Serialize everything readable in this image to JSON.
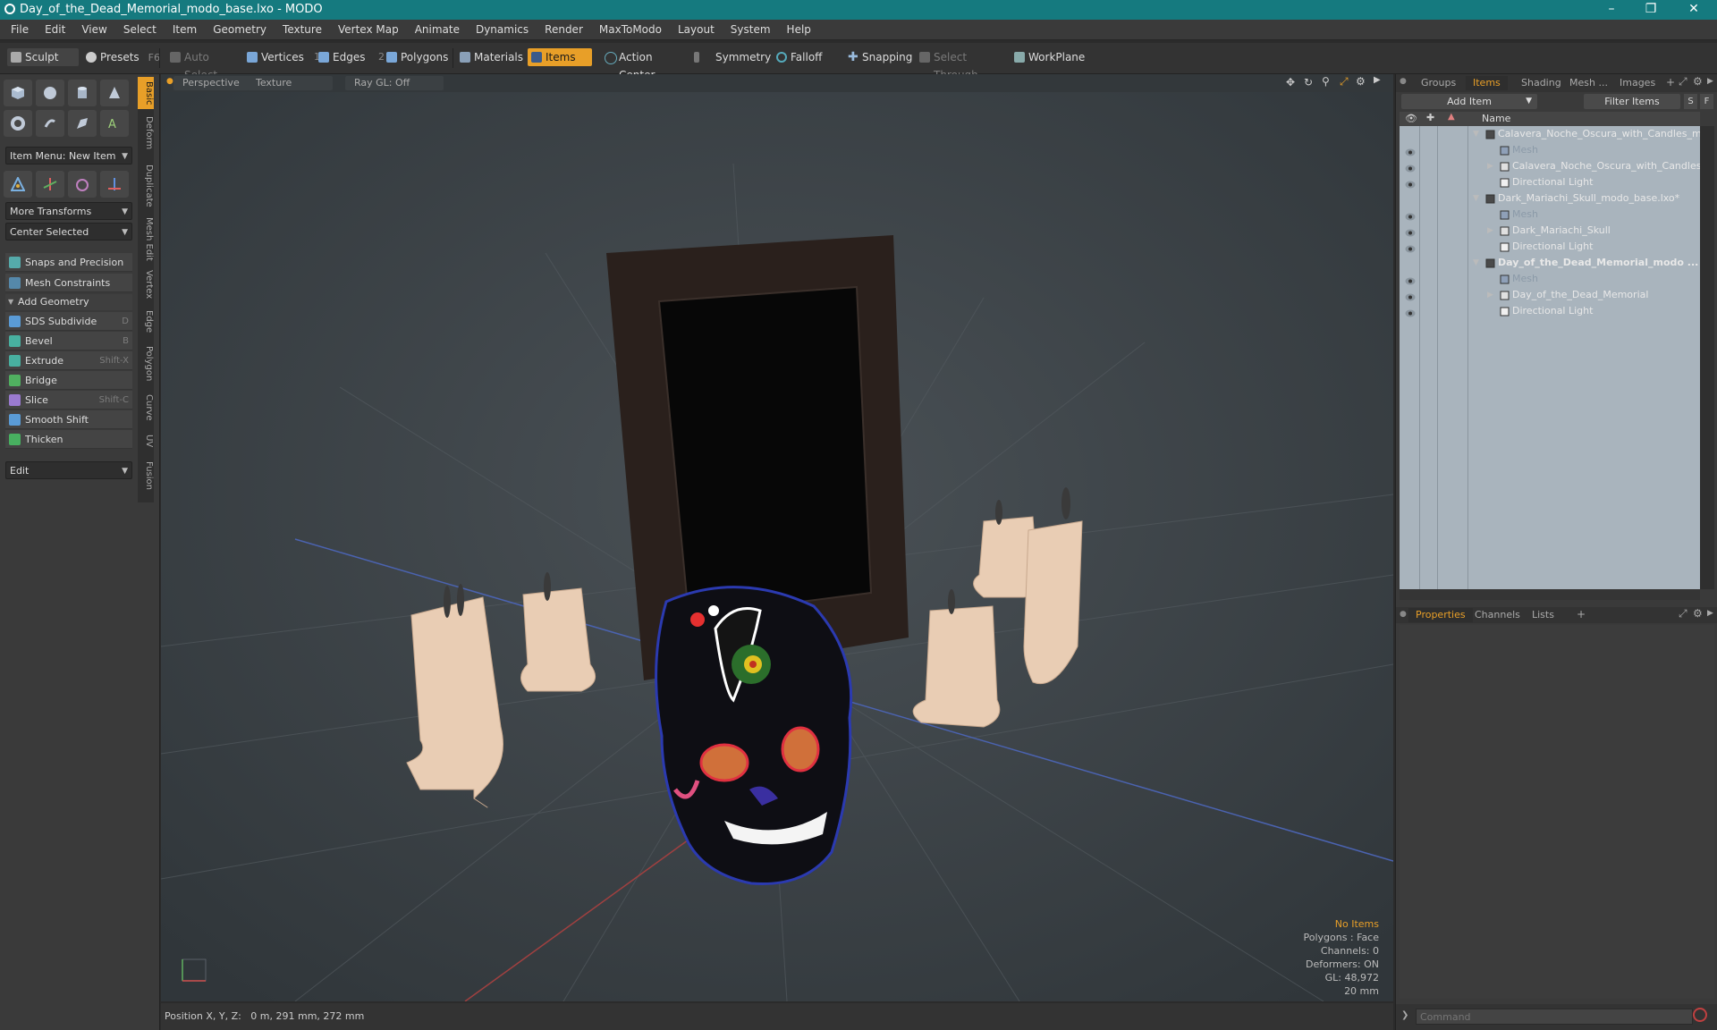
{
  "window": {
    "title": "Day_of_the_Dead_Memorial_modo_base.lxo - MODO"
  },
  "menu": [
    "File",
    "Edit",
    "View",
    "Select",
    "Item",
    "Geometry",
    "Texture",
    "Vertex Map",
    "Animate",
    "Dynamics",
    "Render",
    "MaxToModo",
    "Layout",
    "System",
    "Help"
  ],
  "toolbar": {
    "sculpt": "Sculpt",
    "presets": "Presets",
    "presets_key": "F6",
    "auto_select": "Auto Select",
    "vertices": "Vertices",
    "vertices_key": "1",
    "edges": "Edges",
    "edges_key": "2",
    "polygons": "Polygons",
    "materials": "Materials",
    "items": "Items",
    "action_center": "Action Center",
    "symmetry": "Symmetry",
    "falloff": "Falloff",
    "snapping": "Snapping",
    "select_through": "Select Through",
    "workplane": "WorkPlane"
  },
  "left_panel": {
    "item_menu": "Item Menu: New Item",
    "more_transforms": "More Transforms",
    "center_selected": "Center Selected",
    "snaps": "Snaps and Precision",
    "mesh_constraints": "Mesh Constraints",
    "add_geometry": "Add Geometry",
    "tools": [
      {
        "label": "SDS Subdivide",
        "shortcut": "D",
        "color": "#5a9bd6"
      },
      {
        "label": "Bevel",
        "shortcut": "B",
        "color": "#48b0a0"
      },
      {
        "label": "Extrude",
        "shortcut": "Shift-X",
        "color": "#48b0a0"
      },
      {
        "label": "Bridge",
        "shortcut": "",
        "color": "#50b060"
      },
      {
        "label": "Slice",
        "shortcut": "Shift-C",
        "color": "#9a7ad0"
      },
      {
        "label": "Smooth Shift",
        "shortcut": "",
        "color": "#5a9bd6"
      },
      {
        "label": "Thicken",
        "shortcut": "",
        "color": "#48b060"
      }
    ],
    "edit_dropdown": "Edit"
  },
  "vertical_tabs": [
    "Basic",
    "Deform",
    "Duplicate",
    "Mesh Edit",
    "Vertex",
    "Edge",
    "Polygon",
    "Curve",
    "UV",
    "Fusion"
  ],
  "viewport": {
    "view": "Perspective",
    "shading": "Texture",
    "raygl": "Ray GL: Off",
    "info": {
      "selection": "No Items",
      "polygons": "Polygons : Face",
      "channels": "Channels: 0",
      "deformers": "Deformers: ON",
      "gl": "GL: 48,972",
      "scale": "20 mm"
    }
  },
  "status": {
    "position": "Position X, Y, Z:   0 m, 291 mm, 272 mm"
  },
  "right_panel": {
    "tabs": [
      "Groups",
      "Items",
      "Shading",
      "Mesh ...",
      "Images"
    ],
    "add_item": "Add Item",
    "filter_items": "Filter Items",
    "filter_s": "S",
    "filter_f": "F",
    "column_name": "Name",
    "tree": [
      {
        "label": "Calavera_Noche_Oscura_with_Candles_m ...",
        "level": 0,
        "type": "scene",
        "expanded": true
      },
      {
        "label": "Mesh",
        "level": 1,
        "type": "mesh"
      },
      {
        "label": "Calavera_Noche_Oscura_with_Candles",
        "level": 1,
        "type": "group",
        "collapsed": true
      },
      {
        "label": "Directional Light",
        "level": 1,
        "type": "light"
      },
      {
        "label": "Dark_Mariachi_Skull_modo_base.lxo*",
        "level": 0,
        "type": "scene",
        "expanded": true
      },
      {
        "label": "Mesh",
        "level": 1,
        "type": "mesh"
      },
      {
        "label": "Dark_Mariachi_Skull",
        "level": 1,
        "type": "group",
        "collapsed": true
      },
      {
        "label": "Directional Light",
        "level": 1,
        "type": "light"
      },
      {
        "label": "Day_of_the_Dead_Memorial_modo ...",
        "level": 0,
        "type": "scene",
        "expanded": true,
        "bold": true
      },
      {
        "label": "Mesh",
        "level": 1,
        "type": "mesh"
      },
      {
        "label": "Day_of_the_Dead_Memorial",
        "level": 1,
        "type": "group",
        "collapsed": true
      },
      {
        "label": "Directional Light",
        "level": 1,
        "type": "light"
      }
    ],
    "bottom_tabs": [
      "Properties",
      "Channels",
      "Lists"
    ],
    "command_placeholder": "Command"
  },
  "colors": {
    "accent": "#e89f28",
    "titlebar": "#157a7f"
  }
}
